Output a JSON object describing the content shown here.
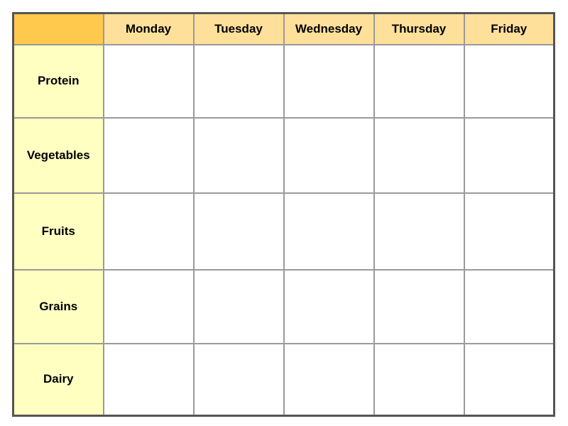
{
  "planner": {
    "corner_label": "",
    "days": [
      "Monday",
      "Tuesday",
      "Wednesday",
      "Thursday",
      "Friday"
    ],
    "categories": [
      "Protein",
      "Vegetables",
      "Fruits",
      "Grains",
      "Dairy"
    ],
    "cells": [
      [
        "",
        "",
        "",
        "",
        ""
      ],
      [
        "",
        "",
        "",
        "",
        ""
      ],
      [
        "",
        "",
        "",
        "",
        ""
      ],
      [
        "",
        "",
        "",
        "",
        ""
      ],
      [
        "",
        "",
        "",
        "",
        ""
      ]
    ],
    "colors": {
      "corner": "#ffc94d",
      "day_header": "#ffe09a",
      "category": "#ffffc2",
      "border": "#9a9a9a",
      "outer_border": "#555555"
    }
  }
}
